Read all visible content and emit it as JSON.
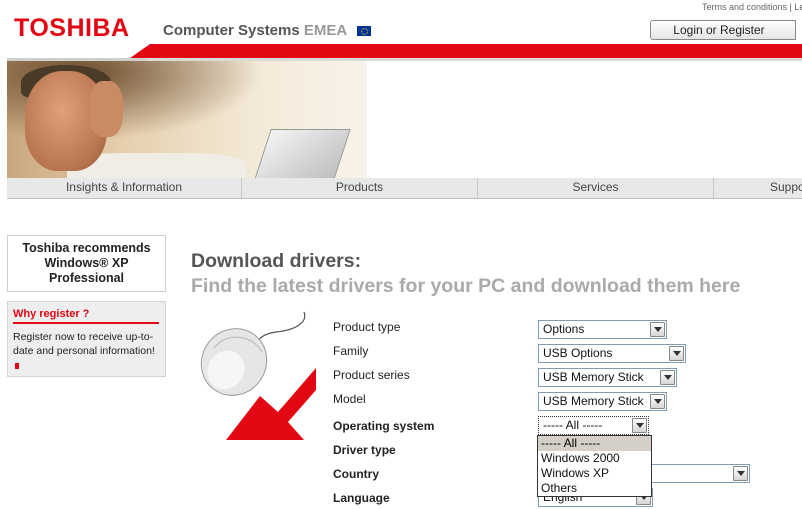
{
  "header": {
    "logo": "TOSHIBA",
    "tagline_main": "Computer Systems",
    "tagline_region": "EMEA",
    "toplinks": "Terms and conditions | Legal",
    "login_button": "Login or Register"
  },
  "nav": {
    "items": [
      "Insights & Information",
      "Products",
      "Services",
      "Support"
    ]
  },
  "sidebar": {
    "recommend_line1": "Toshiba recommends",
    "recommend_line2": "Windows® XP",
    "recommend_line3": "Professional",
    "why_title": "Why register ?",
    "why_body": "Register now to receive up-to-date and personal information!"
  },
  "main": {
    "heading": "Download drivers:",
    "subheading": "Find the latest drivers for your PC and download them here",
    "fields": {
      "product_type": {
        "label": "Product type",
        "value": "Options"
      },
      "family": {
        "label": "Family",
        "value": "USB Options"
      },
      "product_series": {
        "label": "Product series",
        "value": "USB Memory Stick"
      },
      "model": {
        "label": "Model",
        "value": "USB Memory Stick"
      },
      "operating_system": {
        "label": "Operating system",
        "value": "----- All -----"
      },
      "driver_type": {
        "label": "Driver type",
        "value": ""
      },
      "country": {
        "label": "Country",
        "value": ""
      },
      "language": {
        "label": "Language",
        "value": "English"
      }
    },
    "os_options": [
      "----- All -----",
      "Windows 2000",
      "Windows XP",
      "Others"
    ]
  },
  "colors": {
    "brand_red": "#e30613",
    "heading_grey": "#555555",
    "subheading_grey": "#aaaaaa"
  }
}
